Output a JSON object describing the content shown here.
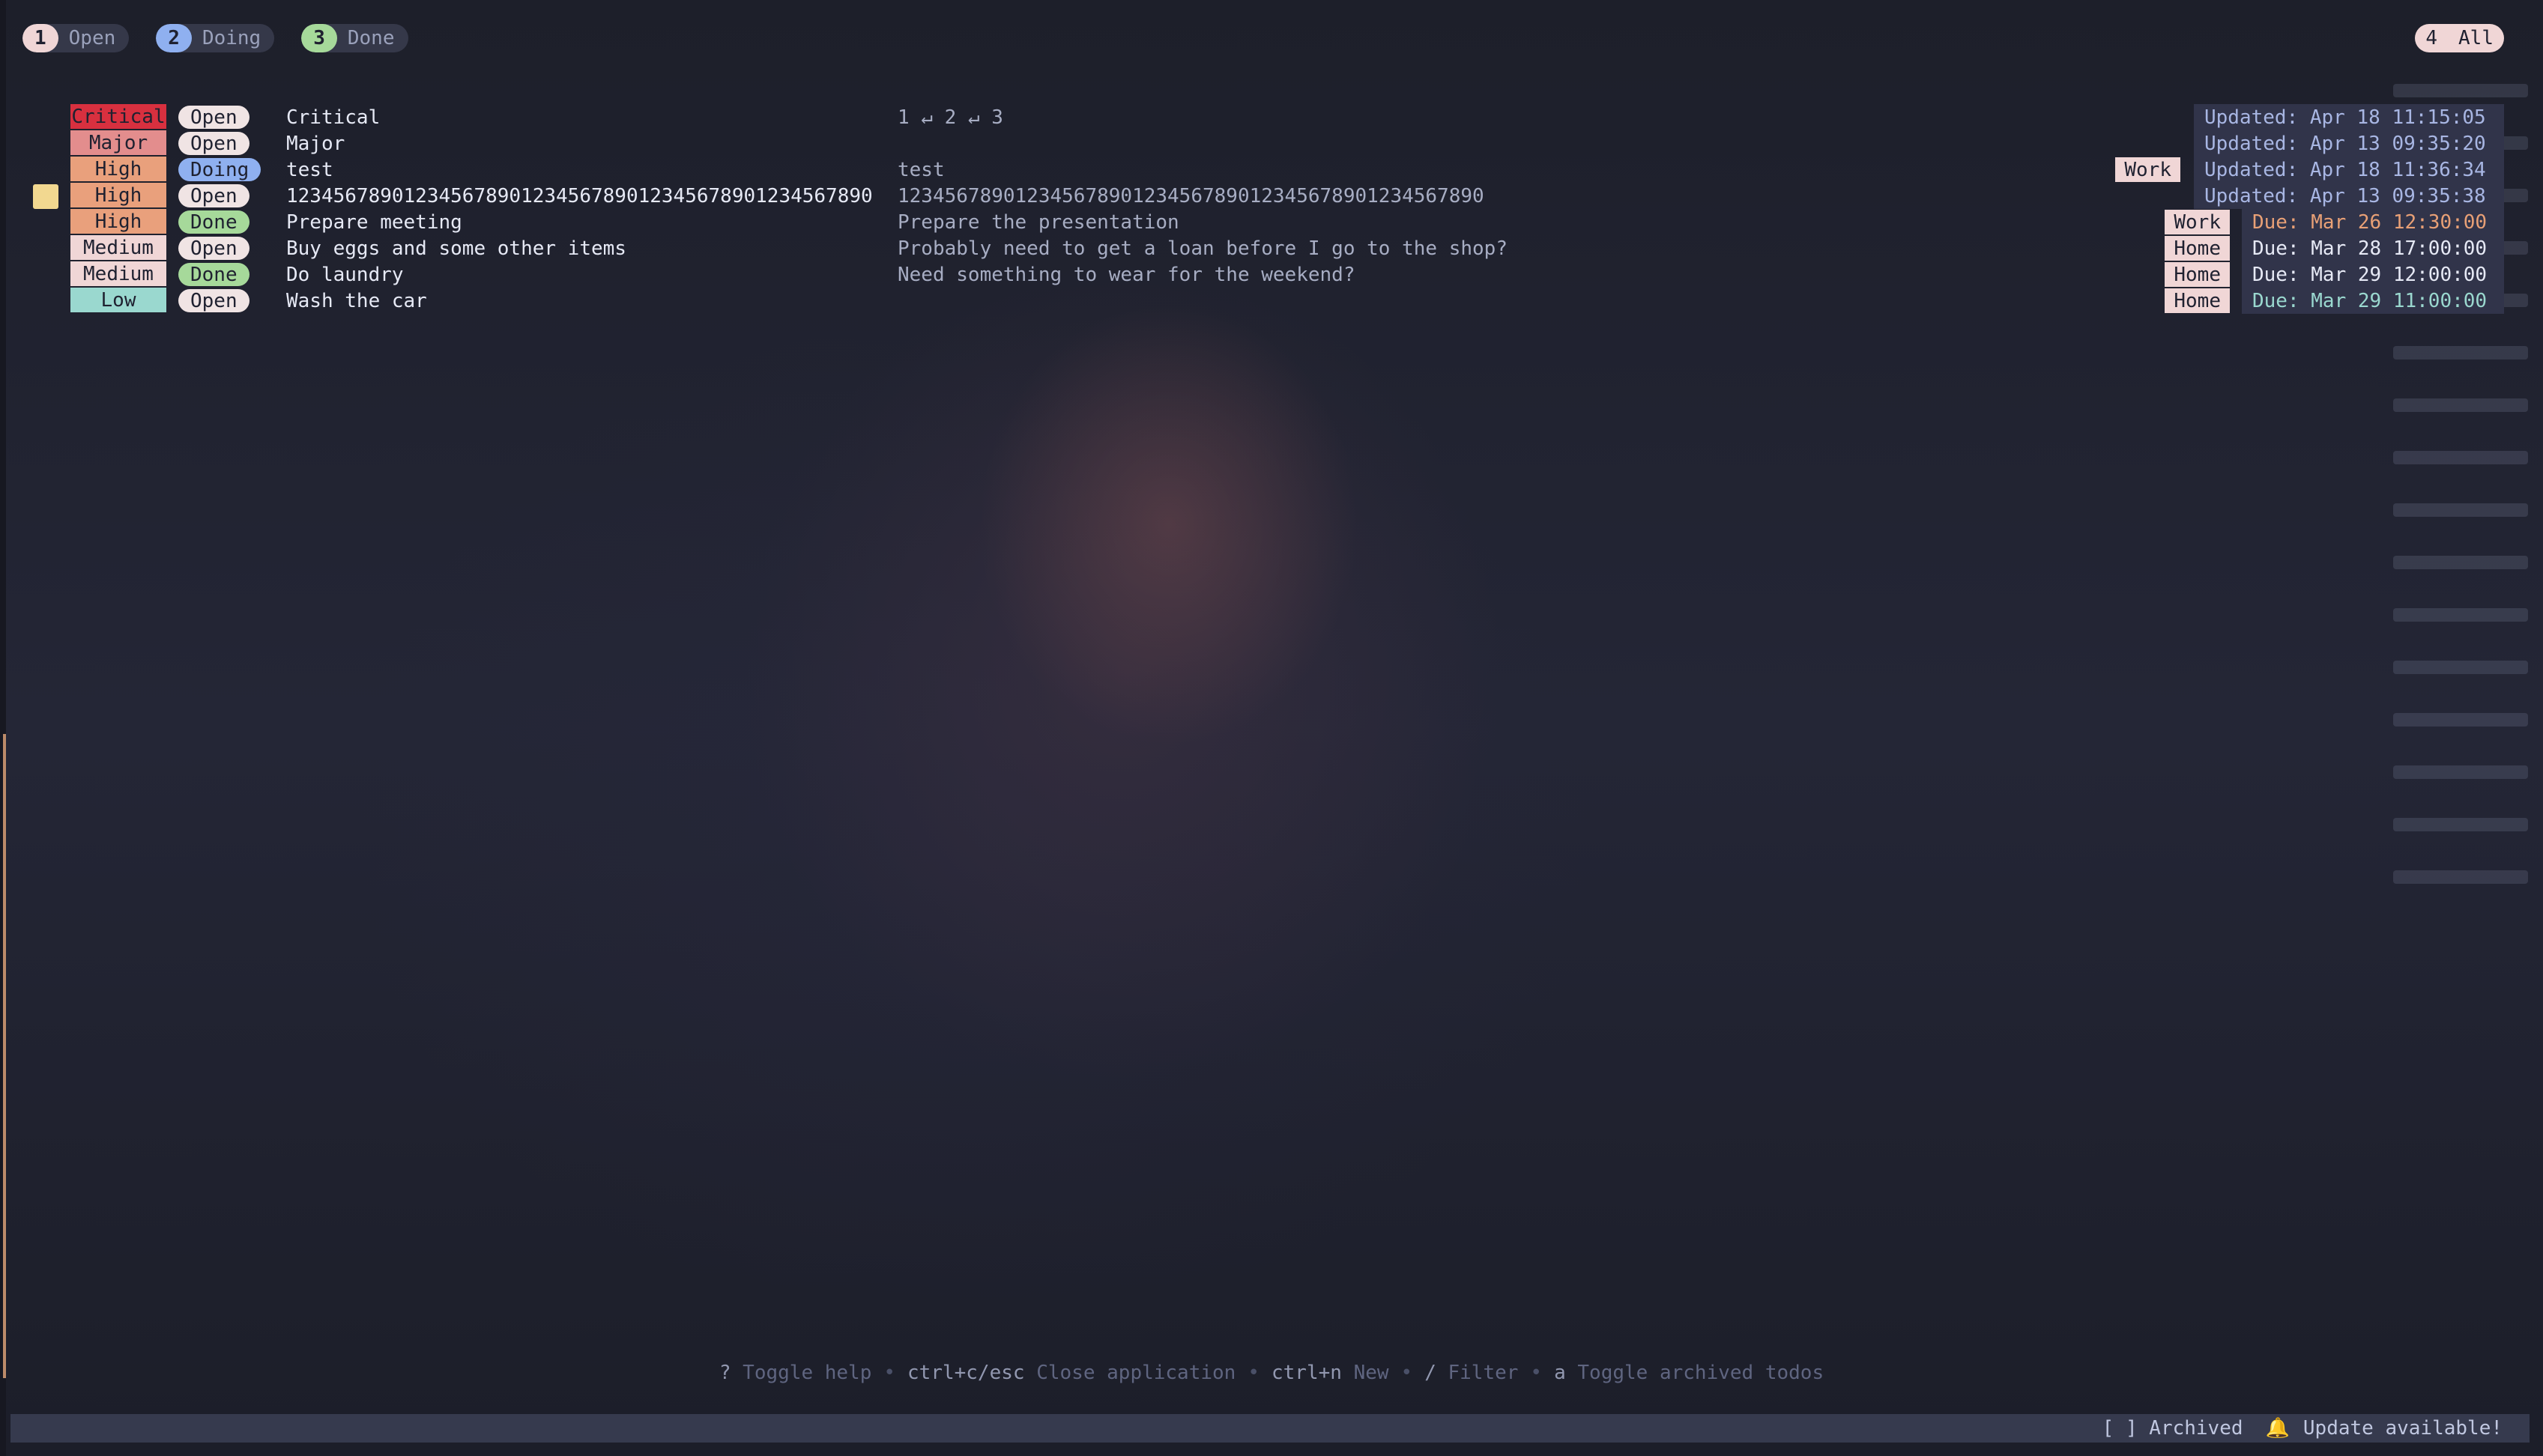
{
  "tabs": [
    {
      "num": "1",
      "label": "Open",
      "color": "#f0d6d6"
    },
    {
      "num": "2",
      "label": "Doing",
      "color": "#8fb0f0"
    },
    {
      "num": "3",
      "label": "Done",
      "color": "#a6d99a"
    }
  ],
  "tab_all": {
    "num": "4",
    "label": "All"
  },
  "todos": [
    {
      "priority": "Critical",
      "priority_color": "#d8303f",
      "status": "Open",
      "status_color": "#f0e4e4",
      "title": "Critical",
      "description": "1 ↵ 2 ↵ 3",
      "tag": "",
      "date": "Updated: Apr 18 11:15:05",
      "date_kind": "updated"
    },
    {
      "priority": "Major",
      "priority_color": "#e38d8d",
      "status": "Open",
      "status_color": "#f0e4e4",
      "title": "Major",
      "description": "",
      "tag": "",
      "date": "Updated: Apr 13 09:35:20",
      "date_kind": "updated"
    },
    {
      "priority": "High",
      "priority_color": "#e9a07c",
      "status": "Doing",
      "status_color": "#8fb0f0",
      "title": "test",
      "description": "test",
      "tag": "Work",
      "date": "Updated: Apr 18 11:36:34",
      "date_kind": "updated"
    },
    {
      "priority": "High",
      "priority_color": "#e9a07c",
      "status": "Open",
      "status_color": "#f0e4e4",
      "title": "12345678901234567890123456789012345678901234567890",
      "description": "12345678901234567890123456789012345678901234567890",
      "tag": "",
      "date": "Updated: Apr 13 09:35:38",
      "date_kind": "updated",
      "selected": true
    },
    {
      "priority": "High",
      "priority_color": "#e9a07c",
      "status": "Done",
      "status_color": "#a6d99a",
      "title": "Prepare meeting",
      "description": "Prepare the presentation",
      "tag": "Work",
      "date": "Due: Mar 26 12:30:00",
      "date_kind": "due",
      "date_color": "#e8a076"
    },
    {
      "priority": "Medium",
      "priority_color": "#f0d6d6",
      "status": "Open",
      "status_color": "#f0e4e4",
      "title": "Buy eggs and some other items",
      "description": "Probably need to get a loan before I go to the shop?",
      "tag": "Home",
      "date": "Due: Mar 28 17:00:00",
      "date_kind": "due",
      "date_color": "#e6e9f5"
    },
    {
      "priority": "Medium",
      "priority_color": "#f0d6d6",
      "status": "Done",
      "status_color": "#a6d99a",
      "title": "Do laundry",
      "description": "Need something to wear for the weekend?",
      "tag": "Home",
      "date": "Due: Mar 29 12:00:00",
      "date_kind": "due",
      "date_color": "#e6e9f5"
    },
    {
      "priority": "Low",
      "priority_color": "#9ad8cf",
      "status": "Open",
      "status_color": "#f0e4e4",
      "title": "Wash the car",
      "description": "",
      "tag": "Home",
      "date": "Due: Mar 29 11:00:00",
      "date_kind": "due",
      "date_color": "#9ad8cf"
    }
  ],
  "help": [
    {
      "key": "?",
      "desc": "Toggle help"
    },
    {
      "key": "ctrl+c/esc",
      "desc": "Close application"
    },
    {
      "key": "ctrl+n",
      "desc": "New"
    },
    {
      "key": "/",
      "desc": "Filter"
    },
    {
      "key": "a",
      "desc": "Toggle archived todos"
    }
  ],
  "help_separator": "•",
  "statusbar": {
    "archived": "[ ] Archived",
    "bell_icon": "bell-icon",
    "bell_glyph": "🔔",
    "update": "Update available!"
  }
}
